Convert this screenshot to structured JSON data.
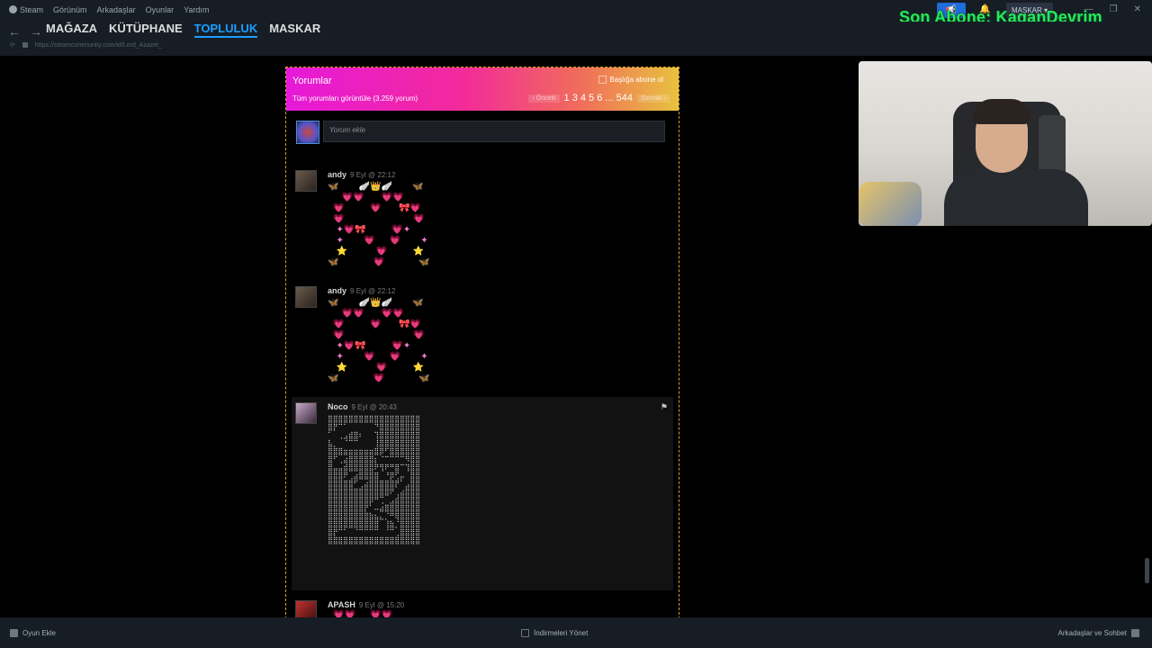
{
  "menu": {
    "items": [
      "Steam",
      "Görünüm",
      "Arkadaşlar",
      "Oyunlar",
      "Yardım"
    ]
  },
  "account": {
    "name": "MASKAR"
  },
  "overlay": {
    "text": "Son Abone: KaganDevrim"
  },
  "nav": {
    "tabs": [
      "MAĞAZA",
      "KÜTÜPHANE",
      "TOPLULUK",
      "MASKAR"
    ],
    "active": "TOPLULUK"
  },
  "url": "https://steamcommunity.com/id/Lord_Azazel_",
  "comments_panel": {
    "title": "Yorumlar",
    "subscribe_label": "Başlığa abone ol",
    "view_all": "Tüm yorumları görüntüle (3.259 yorum)",
    "pagination": {
      "prev": "‹ Önceki",
      "pages": "1   3 4 5 6 ... 544",
      "next": "Sonraki ›"
    },
    "input_placeholder": "Yorum ekle"
  },
  "comments": [
    {
      "user": "andy",
      "date": "9 Eyl @ 22:12",
      "art": "🦋       🪽👑🪽       🦋\n     💗💗      💗💗\n  💗         💗      🎀💗\n  💗                        💗\n   ✦💗🎀         💗✦\n   ✦       💗     💗       ✦\n   ⭐          💗         ⭐\n🦋            💗            🦋"
    },
    {
      "user": "andy",
      "date": "9 Eyl @ 22:12",
      "art": "🦋       🪽👑🪽       🦋\n     💗💗      💗💗\n  💗         💗      🎀💗\n  💗                        💗\n   ✦💗🎀         💗✦\n   ✦       💗     💗       ✦\n   ⭐          💗         ⭐\n🦋            💗            🦋"
    },
    {
      "user": "Noco",
      "date": "9 Eyl @ 20:43",
      "art": "⣿⣿⣿⣿⣿⣿⣿⣿⣿⣿⣿⣿⣿⣿⣿⣿⣿⣿\n⣿⡟⠉⠁⠀⠀⠀⠀⠀⠙⣿⣿⣿⣿⣿⣿⣿⣿\n⠁⠀⢀⣠⣾⣿⠆⠀⠀⢹⣿⣿⣿⣿⣿⣿⣿⣿\n⣧⡀⠀⠈⠉⠉⠀⠀⠀⢸⣿⣿⣿⣿⣿⣿⣿⣿\n⣿⣿⣿⣶⣶⣶⣶⣶⣶⣿⡿⠋⣿⣿⣿⣿⣿⣿\n⣿⠋⢀⣴⣿⣿⣿⣿⣿⡆⠈⠉⠉⠉⠉⠻⣿⣿\n⣿⣤⣤⣾⣿⣿⣿⣿⣿⠟⢻⠟⠛⣿⠉⢹⣿⣿\n⣿⣿⣿⠟⢀⣴⣿⣿⣿⣿⠀⠘⡿⢋⡤⠀⣿⣿\n⣿⣿⣿⣿⣿⠋⢀⣴⣿⣿⣿⣿⣿⡟⠁⣠⣿⣿\n⣿⣿⣿⣿⣿⣿⣿⣿⣿⣿⣿⣿⠟⢀⣴⣿⣿⣿\n⣿⣿⣿⣿⣿⣿⣿⣿⡿⠛⢉⠀⣠⣾⣿⣿⣿⣿\n⣿⣿⣿⣿⣿⣿⣿⡟⠁⠤⣴⣿⣿⣿⣿⣿⣿⣿\n⣿⣿⣿⣿⣿⣿⣿⣿⣷⣦⣄⡈⠛⢿⣿⣿⣿⣿\n⣿⣿⣿⣿⣿⣿⣿⣿⣿⣿⠀⢸⣷⡈⣿⣿⣿⣿\n⣿⡟⠉⠁⠀⠈⠉⠉⠉⠉⠀⠈⠉⢀⣿⣿⣿⣿\n⣿⣿⣿⣿⣿⣿⣿⣿⣿⣿⣿⣿⣿⣿⣿⣿⣿⣿"
    },
    {
      "user": "APASH",
      "date": "9 Eyl @ 15:20",
      "art": "  💗💗     💗💗"
    }
  ],
  "bottom": {
    "add_game": "Oyun Ekle",
    "downloads": "İndirmeleri Yönet",
    "friends": "Arkadaşlar ve Sohbet"
  }
}
